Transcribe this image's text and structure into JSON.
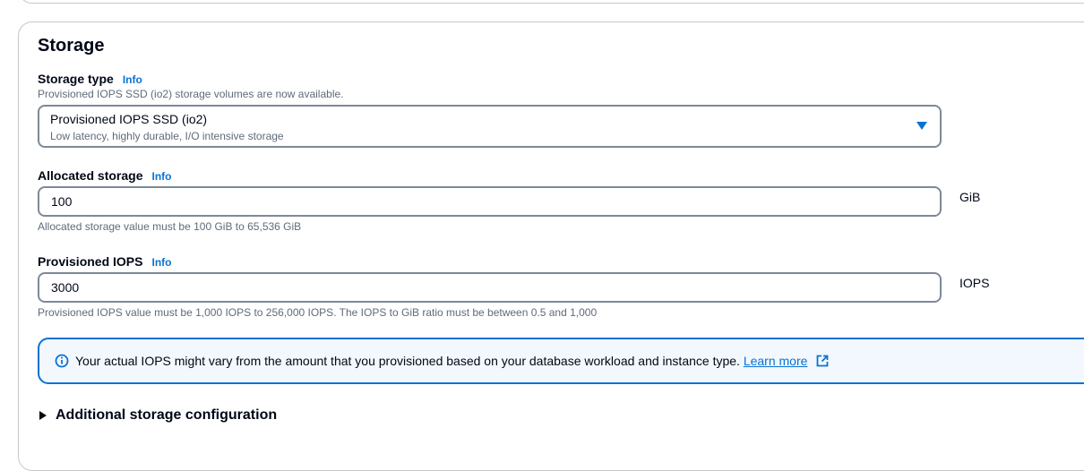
{
  "section": {
    "title": "Storage"
  },
  "storage_type": {
    "label": "Storage type",
    "info": "Info",
    "description": "Provisioned IOPS SSD (io2) storage volumes are now available.",
    "selected_value": "Provisioned IOPS SSD (io2)",
    "selected_description": "Low latency, highly durable, I/O intensive storage"
  },
  "allocated_storage": {
    "label": "Allocated storage",
    "info": "Info",
    "value": "100",
    "unit": "GiB",
    "constraint": "Allocated storage value must be 100 GiB to 65,536 GiB"
  },
  "provisioned_iops": {
    "label": "Provisioned IOPS",
    "info": "Info",
    "value": "3000",
    "unit": "IOPS",
    "constraint": "Provisioned IOPS value must be 1,000 IOPS to 256,000 IOPS. The IOPS to GiB ratio must be between 0.5 and 1,000"
  },
  "alert": {
    "icon": "info-icon",
    "message": "Your actual IOPS might vary from the amount that you provisioned based on your database workload and instance type.",
    "link_label": "Learn more",
    "link_icon": "external-link-icon"
  },
  "additional": {
    "label": "Additional storage configuration"
  },
  "colors": {
    "link": "#0972d3",
    "text": "#000716",
    "muted": "#5f6b7a",
    "border": "#7d8998",
    "alert_bg": "#f2f8fd"
  }
}
